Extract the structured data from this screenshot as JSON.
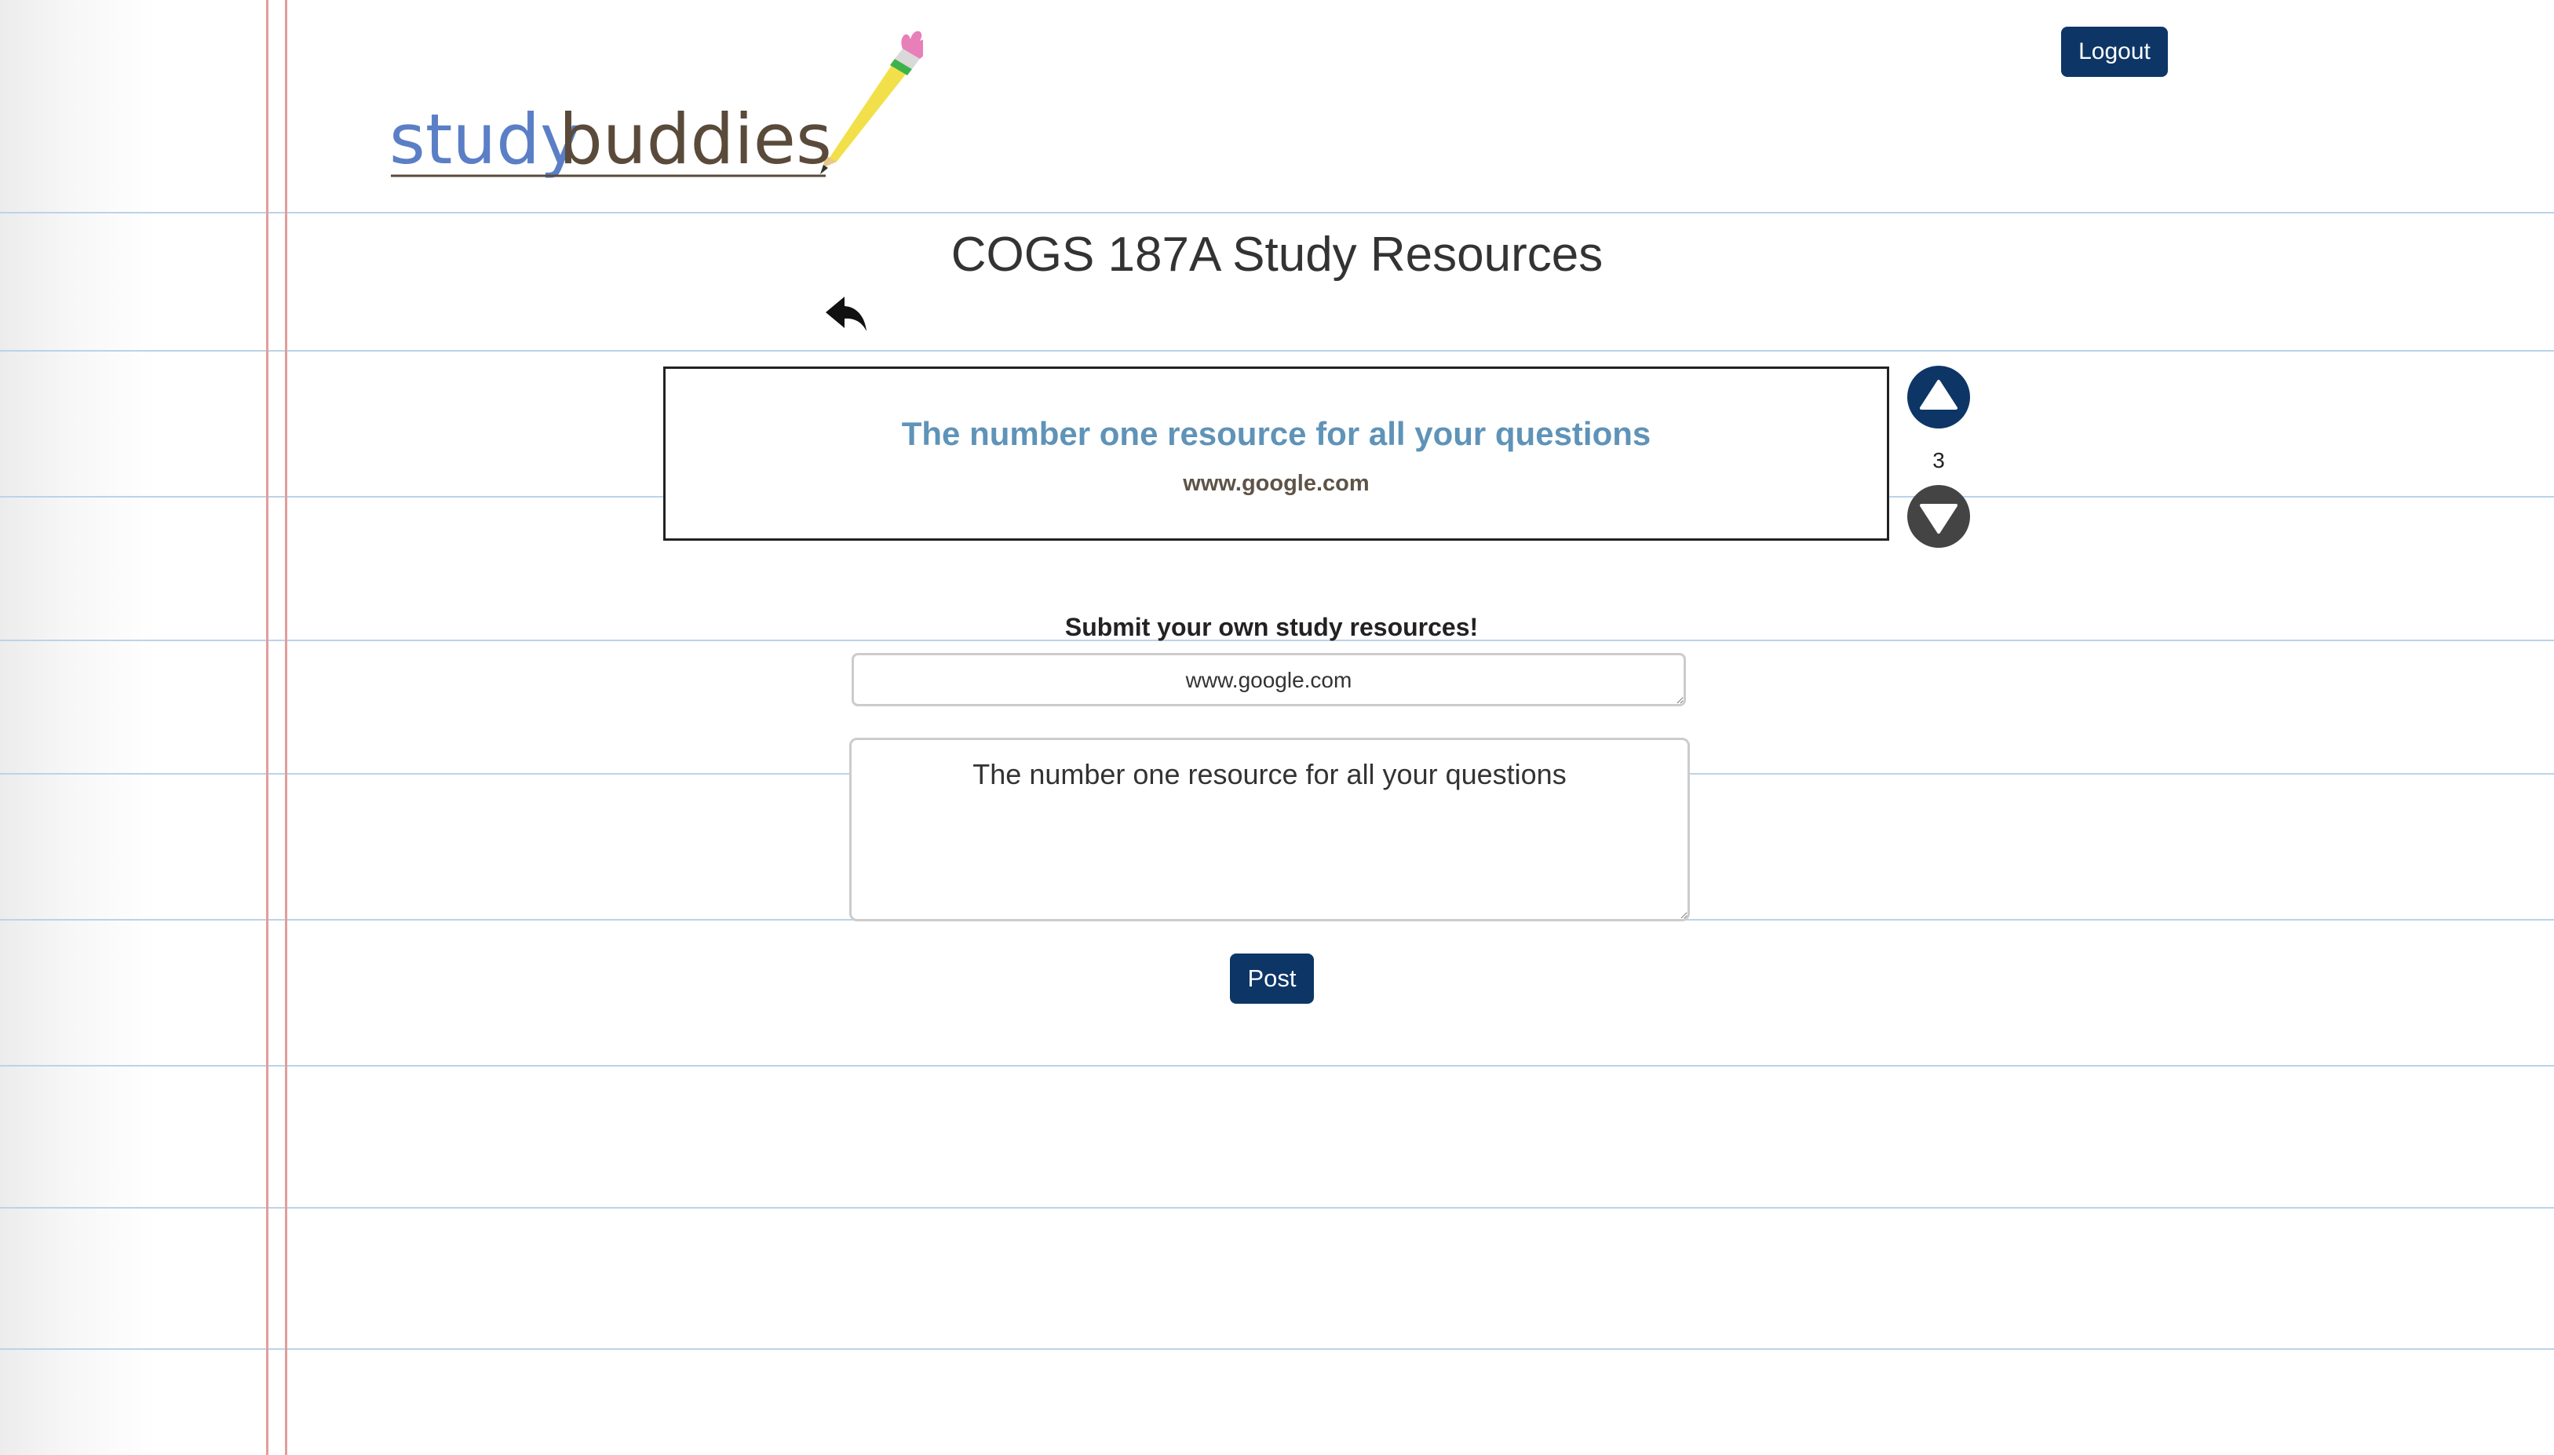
{
  "header": {
    "logo_text_study": "study",
    "logo_text_buddies": "buddies",
    "logout_label": "Logout"
  },
  "page": {
    "title": "COGS 187A Study Resources"
  },
  "resources": [
    {
      "title": "The number one resource for all your questions",
      "link": "www.google.com",
      "votes": "3"
    }
  ],
  "submit_form": {
    "heading": "Submit your own study resources!",
    "url_value": "www.google.com",
    "description_value": "The number one resource for all your questions",
    "post_label": "Post"
  },
  "icons": {
    "back": "reply-arrow-icon",
    "upvote": "upvote-triangle-icon",
    "downvote": "downvote-triangle-icon"
  },
  "colors": {
    "primary_button": "#0d3666",
    "resource_title": "#5f93b8",
    "rule_line": "#bcd3e8",
    "margin_line": "#e49c9c"
  }
}
